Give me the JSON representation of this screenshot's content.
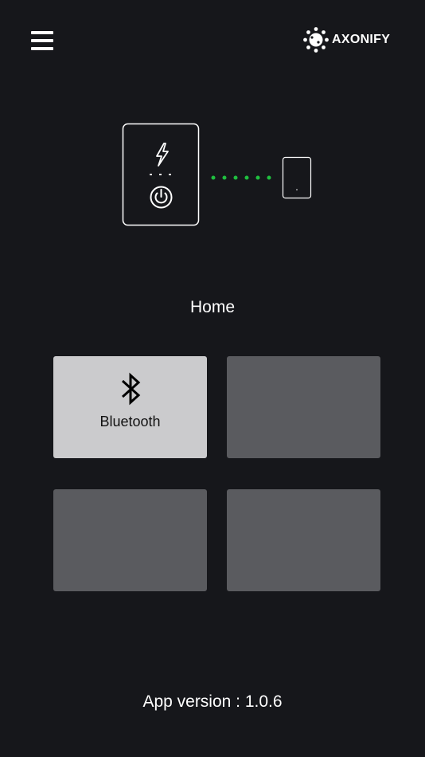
{
  "header": {
    "menu_icon": "hamburger-menu-icon",
    "brand_icon": "axonify-logo-icon",
    "brand_name": "AXONIFY"
  },
  "illustration": {
    "device_icons": [
      "lightning-icon",
      "power-icon"
    ],
    "connection_dot_color": "#1fbf3f",
    "connection_dot_count": 6
  },
  "home": {
    "title": "Home",
    "tiles": [
      {
        "label": "Bluetooth",
        "icon": "bluetooth-icon",
        "active": true
      },
      {
        "label": "",
        "active": false
      },
      {
        "label": "",
        "active": false
      },
      {
        "label": "",
        "active": false
      }
    ]
  },
  "footer": {
    "version_text": "App version : 1.0.6"
  }
}
